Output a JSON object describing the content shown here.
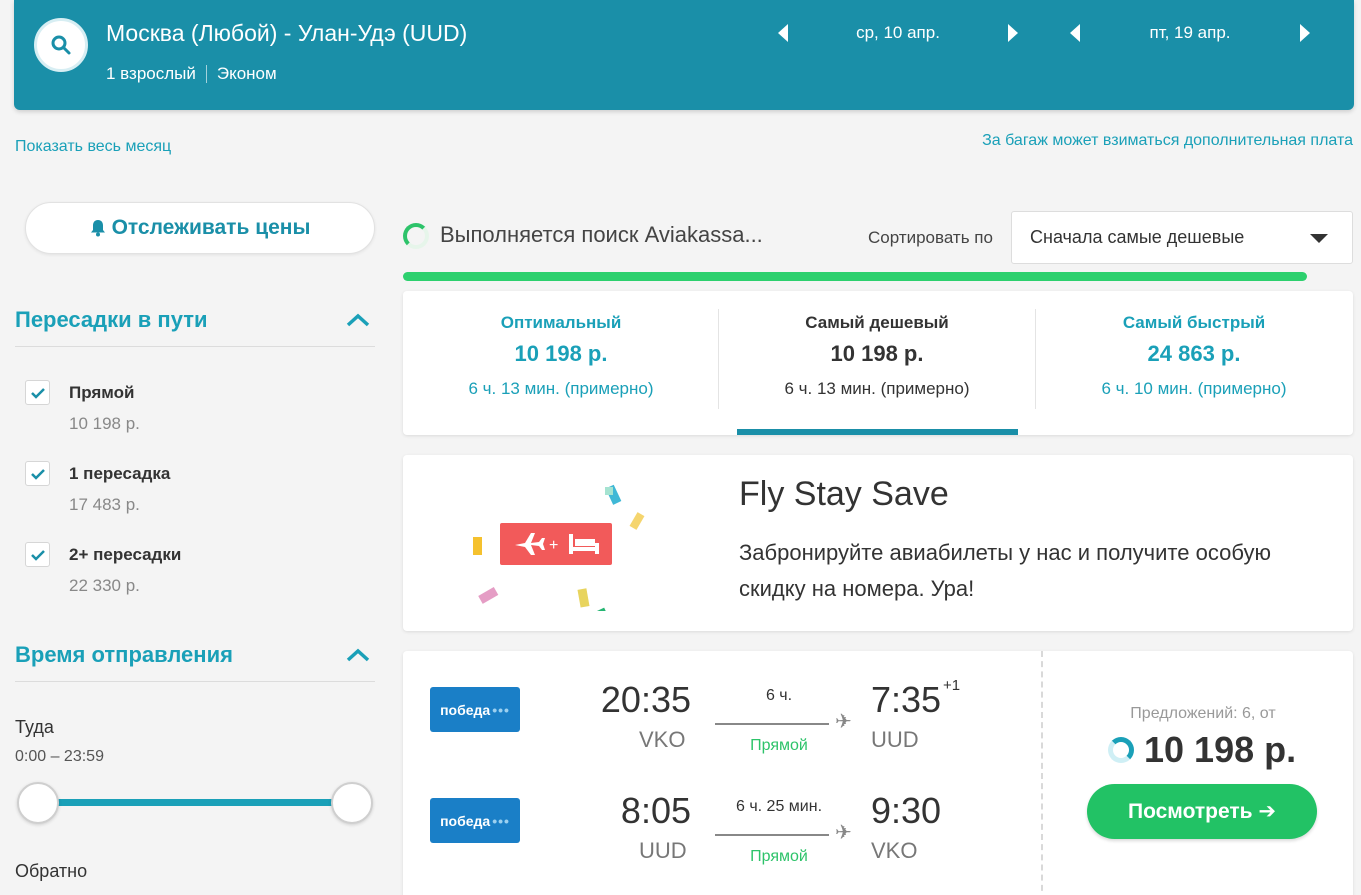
{
  "header": {
    "route": "Москва (Любой) - Улан-Удэ (UUD)",
    "passengers": "1 взрослый",
    "cabin": "Эконом",
    "depart_date": "ср, 10 апр.",
    "return_date": "пт, 19 апр.",
    "accent_color": "#1a8fa8"
  },
  "links": {
    "show_month": "Показать весь месяц",
    "baggage_note": "За багаж может взиматься дополнительная плата"
  },
  "filters": {
    "track_label": "Отслеживать цены",
    "stops_title": "Пересадки в пути",
    "stops": [
      {
        "label": "Прямой",
        "price": "10 198 р.",
        "checked": true
      },
      {
        "label": "1 пересадка",
        "price": "17 483 р.",
        "checked": true
      },
      {
        "label": "2+ пересадки",
        "price": "22 330 р.",
        "checked": true
      }
    ],
    "departure_title": "Время отправления",
    "outbound_label": "Туда",
    "outbound_range": "0:00 – 23:59",
    "return_label": "Обратно"
  },
  "search": {
    "status": "Выполняется поиск Aviakassa...",
    "sort_label": "Сортировать по",
    "sort_value": "Сначала самые дешевые"
  },
  "summary_tabs": [
    {
      "title": "Оптимальный",
      "price": "10 198 р.",
      "duration": "6 ч. 13 мин. (примерно)"
    },
    {
      "title": "Самый дешевый",
      "price": "10 198 р.",
      "duration": "6 ч. 13 мин. (примерно)",
      "active": true
    },
    {
      "title": "Самый быстрый",
      "price": "24 863 р.",
      "duration": "6 ч. 10 мин. (примерно)"
    }
  ],
  "promo": {
    "title": "Fly Stay Save",
    "text": "Забронируйте авиабилеты у нас и получите особую скидку на номера. Ура!",
    "plus": "+"
  },
  "ticket": {
    "outbound": {
      "airline": "победа",
      "dep_time": "20:35",
      "dep_code": "VKO",
      "duration": "6 ч.",
      "type": "Прямой",
      "arr_time": "7:35",
      "arr_day_offset": "+1",
      "arr_code": "UUD"
    },
    "return": {
      "airline": "победа",
      "dep_time": "8:05",
      "dep_code": "UUD",
      "duration": "6 ч. 25 мин.",
      "type": "Прямой",
      "arr_time": "9:30",
      "arr_code": "VKO"
    },
    "offers": "Предложений: 6, от",
    "price": "10 198 р.",
    "view_label": "Посмотреть ➔"
  }
}
